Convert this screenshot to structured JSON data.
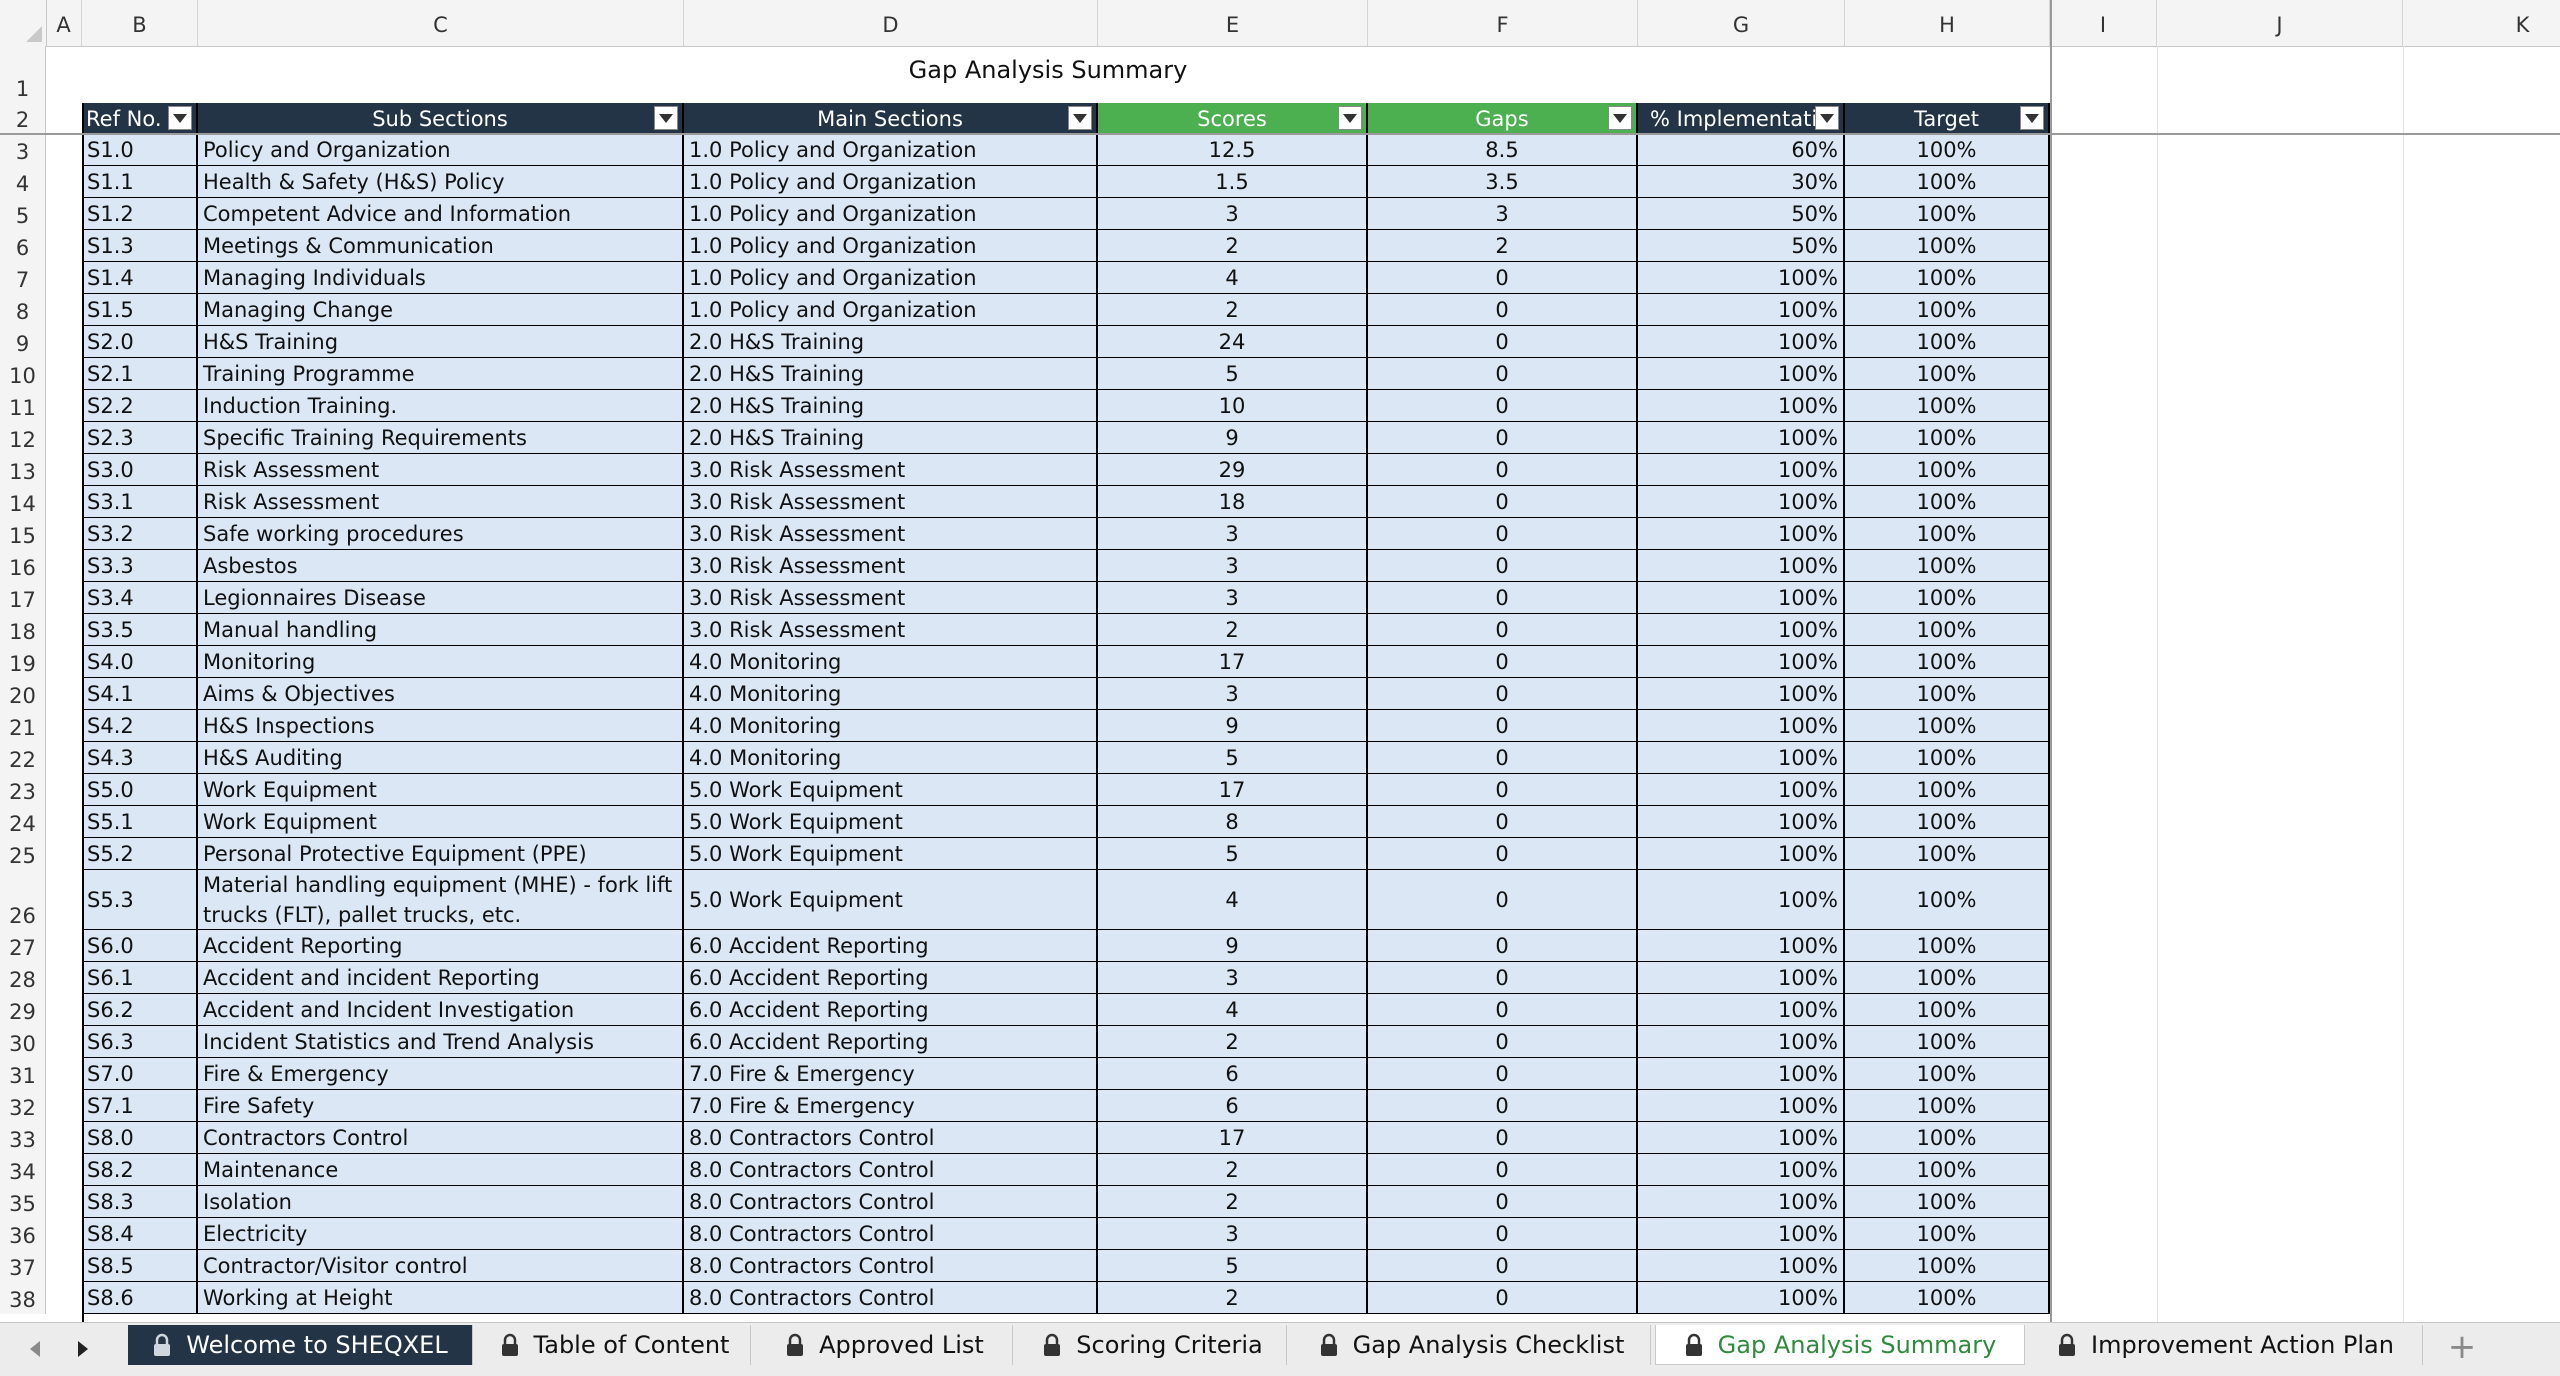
{
  "sheet": {
    "column_letters": [
      "A",
      "B",
      "C",
      "D",
      "E",
      "F",
      "G",
      "H",
      "I",
      "J",
      "K"
    ],
    "title": "Gap Analysis Summary",
    "headers": {
      "ref": "Ref No.",
      "sub": "Sub Sections",
      "main": "Main Sections",
      "scores": "Scores",
      "gaps": "Gaps",
      "impl": "% Implementatio",
      "target": "Target"
    },
    "rows": [
      {
        "num": "3",
        "ref": "S1.0",
        "sub": "Policy and Organization",
        "main": "1.0 Policy and Organization",
        "scores": "12.5",
        "gaps": "8.5",
        "impl": "60%",
        "target": "100%"
      },
      {
        "num": "4",
        "ref": "S1.1",
        "sub": "Health & Safety (H&S) Policy",
        "main": "1.0 Policy and Organization",
        "scores": "1.5",
        "gaps": "3.5",
        "impl": "30%",
        "target": "100%"
      },
      {
        "num": "5",
        "ref": "S1.2",
        "sub": "Competent Advice and Information",
        "main": "1.0 Policy and Organization",
        "scores": "3",
        "gaps": "3",
        "impl": "50%",
        "target": "100%"
      },
      {
        "num": "6",
        "ref": "S1.3",
        "sub": "Meetings & Communication",
        "main": "1.0 Policy and Organization",
        "scores": "2",
        "gaps": "2",
        "impl": "50%",
        "target": "100%"
      },
      {
        "num": "7",
        "ref": "S1.4",
        "sub": "Managing Individuals",
        "main": "1.0 Policy and Organization",
        "scores": "4",
        "gaps": "0",
        "impl": "100%",
        "target": "100%"
      },
      {
        "num": "8",
        "ref": "S1.5",
        "sub": "Managing Change",
        "main": "1.0 Policy and Organization",
        "scores": "2",
        "gaps": "0",
        "impl": "100%",
        "target": "100%"
      },
      {
        "num": "9",
        "ref": "S2.0",
        "sub": "H&S Training",
        "main": "2.0 H&S Training",
        "scores": "24",
        "gaps": "0",
        "impl": "100%",
        "target": "100%"
      },
      {
        "num": "10",
        "ref": "S2.1",
        "sub": "Training Programme",
        "main": "2.0 H&S Training",
        "scores": "5",
        "gaps": "0",
        "impl": "100%",
        "target": "100%"
      },
      {
        "num": "11",
        "ref": "S2.2",
        "sub": "Induction Training.",
        "main": "2.0 H&S Training",
        "scores": "10",
        "gaps": "0",
        "impl": "100%",
        "target": "100%"
      },
      {
        "num": "12",
        "ref": "S2.3",
        "sub": "Specific Training Requirements",
        "main": "2.0 H&S Training",
        "scores": "9",
        "gaps": "0",
        "impl": "100%",
        "target": "100%"
      },
      {
        "num": "13",
        "ref": "S3.0",
        "sub": "Risk Assessment",
        "main": "3.0 Risk Assessment",
        "scores": "29",
        "gaps": "0",
        "impl": "100%",
        "target": "100%"
      },
      {
        "num": "14",
        "ref": "S3.1",
        "sub": "Risk Assessment",
        "main": "3.0 Risk Assessment",
        "scores": "18",
        "gaps": "0",
        "impl": "100%",
        "target": "100%"
      },
      {
        "num": "15",
        "ref": "S3.2",
        "sub": "Safe working procedures",
        "main": "3.0 Risk Assessment",
        "scores": "3",
        "gaps": "0",
        "impl": "100%",
        "target": "100%"
      },
      {
        "num": "16",
        "ref": "S3.3",
        "sub": "Asbestos",
        "main": "3.0 Risk Assessment",
        "scores": "3",
        "gaps": "0",
        "impl": "100%",
        "target": "100%"
      },
      {
        "num": "17",
        "ref": "S3.4",
        "sub": "Legionnaires Disease",
        "main": "3.0 Risk Assessment",
        "scores": "3",
        "gaps": "0",
        "impl": "100%",
        "target": "100%"
      },
      {
        "num": "18",
        "ref": "S3.5",
        "sub": "Manual handling",
        "main": "3.0 Risk Assessment",
        "scores": "2",
        "gaps": "0",
        "impl": "100%",
        "target": "100%"
      },
      {
        "num": "19",
        "ref": "S4.0",
        "sub": "Monitoring",
        "main": "4.0 Monitoring",
        "scores": "17",
        "gaps": "0",
        "impl": "100%",
        "target": "100%"
      },
      {
        "num": "20",
        "ref": "S4.1",
        "sub": "Aims & Objectives",
        "main": "4.0 Monitoring",
        "scores": "3",
        "gaps": "0",
        "impl": "100%",
        "target": "100%"
      },
      {
        "num": "21",
        "ref": "S4.2",
        "sub": "H&S Inspections",
        "main": "4.0 Monitoring",
        "scores": "9",
        "gaps": "0",
        "impl": "100%",
        "target": "100%"
      },
      {
        "num": "22",
        "ref": "S4.3",
        "sub": "H&S Auditing",
        "main": "4.0 Monitoring",
        "scores": "5",
        "gaps": "0",
        "impl": "100%",
        "target": "100%"
      },
      {
        "num": "23",
        "ref": "S5.0",
        "sub": "Work Equipment",
        "main": "5.0 Work Equipment",
        "scores": "17",
        "gaps": "0",
        "impl": "100%",
        "target": "100%"
      },
      {
        "num": "24",
        "ref": "S5.1",
        "sub": "Work Equipment",
        "main": "5.0 Work Equipment",
        "scores": "8",
        "gaps": "0",
        "impl": "100%",
        "target": "100%"
      },
      {
        "num": "25",
        "ref": "S5.2",
        "sub": "Personal Protective Equipment (PPE)",
        "main": "5.0 Work Equipment",
        "scores": "5",
        "gaps": "0",
        "impl": "100%",
        "target": "100%"
      },
      {
        "num": "26",
        "ref": "S5.3",
        "sub": "Material handling equipment (MHE) - fork lift trucks (FLT), pallet trucks, etc.",
        "main": "5.0 Work Equipment",
        "scores": "4",
        "gaps": "0",
        "impl": "100%",
        "target": "100%"
      },
      {
        "num": "27",
        "ref": "S6.0",
        "sub": "Accident Reporting",
        "main": "6.0 Accident Reporting",
        "scores": "9",
        "gaps": "0",
        "impl": "100%",
        "target": "100%"
      },
      {
        "num": "28",
        "ref": "S6.1",
        "sub": "Accident and incident Reporting",
        "main": "6.0 Accident Reporting",
        "scores": "3",
        "gaps": "0",
        "impl": "100%",
        "target": "100%"
      },
      {
        "num": "29",
        "ref": "S6.2",
        "sub": "Accident and Incident Investigation",
        "main": "6.0 Accident Reporting",
        "scores": "4",
        "gaps": "0",
        "impl": "100%",
        "target": "100%"
      },
      {
        "num": "30",
        "ref": "S6.3",
        "sub": "Incident Statistics and Trend Analysis",
        "main": "6.0 Accident Reporting",
        "scores": "2",
        "gaps": "0",
        "impl": "100%",
        "target": "100%"
      },
      {
        "num": "31",
        "ref": "S7.0",
        "sub": "Fire & Emergency",
        "main": "7.0 Fire & Emergency",
        "scores": "6",
        "gaps": "0",
        "impl": "100%",
        "target": "100%"
      },
      {
        "num": "32",
        "ref": "S7.1",
        "sub": "Fire Safety",
        "main": "7.0 Fire & Emergency",
        "scores": "6",
        "gaps": "0",
        "impl": "100%",
        "target": "100%"
      },
      {
        "num": "33",
        "ref": "S8.0",
        "sub": "Contractors Control",
        "main": "8.0 Contractors Control",
        "scores": "17",
        "gaps": "0",
        "impl": "100%",
        "target": "100%"
      },
      {
        "num": "34",
        "ref": "S8.2",
        "sub": "Maintenance",
        "main": "8.0 Contractors Control",
        "scores": "2",
        "gaps": "0",
        "impl": "100%",
        "target": "100%"
      },
      {
        "num": "35",
        "ref": "S8.3",
        "sub": "Isolation",
        "main": "8.0 Contractors Control",
        "scores": "2",
        "gaps": "0",
        "impl": "100%",
        "target": "100%"
      },
      {
        "num": "36",
        "ref": "S8.4",
        "sub": "Electricity",
        "main": "8.0 Contractors Control",
        "scores": "3",
        "gaps": "0",
        "impl": "100%",
        "target": "100%"
      },
      {
        "num": "37",
        "ref": "S8.5",
        "sub": "Contractor/Visitor control",
        "main": "8.0 Contractors Control",
        "scores": "5",
        "gaps": "0",
        "impl": "100%",
        "target": "100%"
      },
      {
        "num": "38",
        "ref": "S8.6",
        "sub": "Working at Height",
        "main": "8.0 Contractors Control",
        "scores": "2",
        "gaps": "0",
        "impl": "100%",
        "target": "100%"
      }
    ]
  },
  "tabs": [
    {
      "label": "Welcome to SHEQXEL",
      "style": "dark",
      "icon": "lock-icon"
    },
    {
      "label": "Table of Content",
      "style": "normal",
      "icon": "lock-icon"
    },
    {
      "label": "Approved List",
      "style": "normal",
      "icon": "lock-icon"
    },
    {
      "label": "Scoring Criteria",
      "style": "normal",
      "icon": "lock-icon"
    },
    {
      "label": "Gap Analysis Checklist",
      "style": "normal",
      "icon": "lock-icon"
    },
    {
      "label": "Gap Analysis Summary",
      "style": "active",
      "icon": "lock-icon"
    },
    {
      "label": "Improvement Action Plan",
      "style": "normal",
      "icon": "lock-icon"
    }
  ],
  "add_tab_label": "+",
  "colors": {
    "header_dark": "#243447",
    "header_green": "#4caf50",
    "row_fill": "#dbe7f4",
    "active_tab_text": "#2e8b3e"
  }
}
